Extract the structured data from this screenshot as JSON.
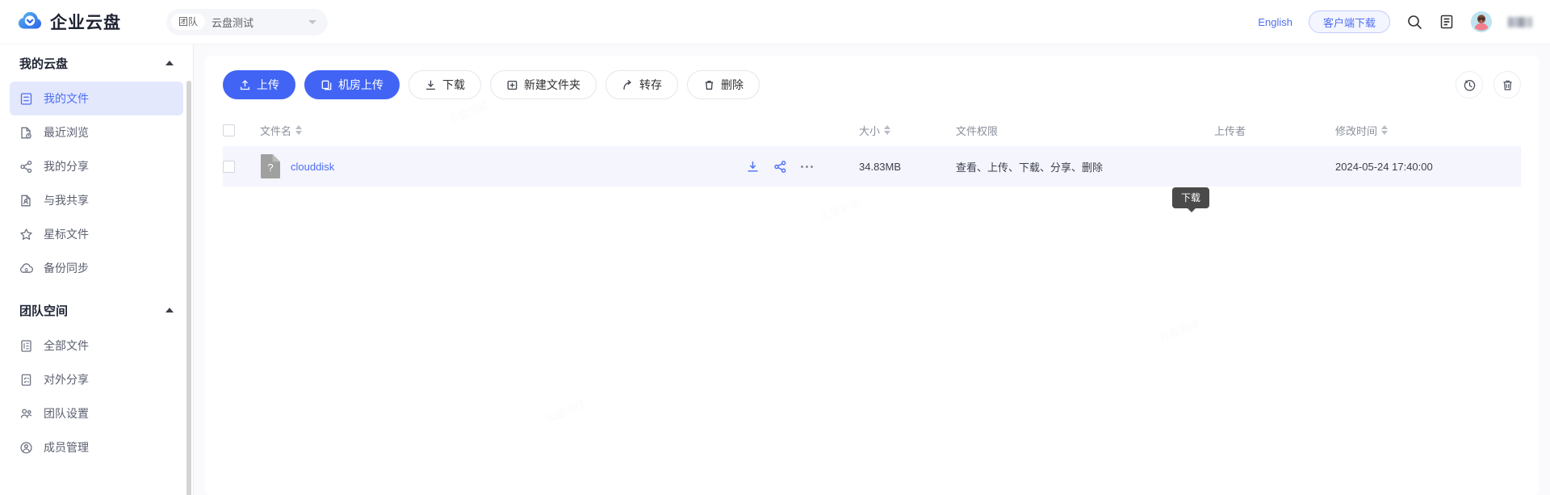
{
  "header": {
    "brand_name": "企业云盘",
    "logo_icon": "cloud-check-icon",
    "team_tag": "团队",
    "team_name": "云盘测试",
    "team_caret_icon": "chevron-down-icon",
    "language_link": "English",
    "client_download": "客户端下载",
    "search_icon": "search-icon",
    "notes_icon": "document-list-icon",
    "avatar_icon": "user-avatar",
    "user_name": ""
  },
  "sidebar": {
    "groups": [
      {
        "title": "我的云盘",
        "collapse_icon": "chevron-up-icon",
        "items": [
          {
            "label": "我的文件",
            "icon": "file-icon",
            "active": true
          },
          {
            "label": "最近浏览",
            "icon": "recent-file-icon",
            "active": false
          },
          {
            "label": "我的分享",
            "icon": "share-icon",
            "active": false
          },
          {
            "label": "与我共享",
            "icon": "shared-with-me-icon",
            "active": false
          },
          {
            "label": "星标文件",
            "icon": "star-icon",
            "active": false
          },
          {
            "label": "备份同步",
            "icon": "cloud-sync-icon",
            "active": false
          }
        ]
      },
      {
        "title": "团队空间",
        "collapse_icon": "chevron-up-icon",
        "items": [
          {
            "label": "全部文件",
            "icon": "list-file-icon",
            "active": false
          },
          {
            "label": "对外分享",
            "icon": "external-share-icon",
            "active": false
          },
          {
            "label": "团队设置",
            "icon": "team-settings-icon",
            "active": false
          },
          {
            "label": "成员管理",
            "icon": "member-manage-icon",
            "active": false
          }
        ]
      }
    ]
  },
  "toolbar": {
    "buttons": [
      {
        "label": "上传",
        "icon": "upload-icon",
        "primary": true
      },
      {
        "label": "机房上传",
        "icon": "server-upload-icon",
        "primary": true
      },
      {
        "label": "下载",
        "icon": "download-icon",
        "primary": false
      },
      {
        "label": "新建文件夹",
        "icon": "new-folder-icon",
        "primary": false
      },
      {
        "label": "转存",
        "icon": "transfer-save-icon",
        "primary": false
      },
      {
        "label": "删除",
        "icon": "trash-icon",
        "primary": false
      }
    ],
    "right_icons": [
      {
        "name": "history-icon"
      },
      {
        "name": "recycle-bin-icon"
      }
    ]
  },
  "table": {
    "columns": [
      {
        "key": "checkbox",
        "label": "",
        "sortable": false
      },
      {
        "key": "name",
        "label": "文件名",
        "sortable": true
      },
      {
        "key": "actions",
        "label": "",
        "sortable": false
      },
      {
        "key": "size",
        "label": "大小",
        "sortable": true
      },
      {
        "key": "permission",
        "label": "文件权限",
        "sortable": false
      },
      {
        "key": "uploader",
        "label": "上传者",
        "sortable": false
      },
      {
        "key": "modified",
        "label": "修改时间",
        "sortable": true
      }
    ],
    "rows": [
      {
        "name": "clouddisk",
        "file_icon": "unknown-file-icon",
        "size": "34.83MB",
        "permission": "查看、上传、下载、分享、删除",
        "uploader": "",
        "modified": "2024-05-24 17:40:00",
        "actions": [
          {
            "name": "download-icon"
          },
          {
            "name": "share-icon"
          },
          {
            "name": "more-icon"
          }
        ]
      }
    ]
  },
  "tooltip": {
    "text": "下载"
  },
  "colors": {
    "primary": "#4264f5",
    "link": "#4e6ef2",
    "active_bg": "#e4e8fd",
    "row_bg": "#f4f5fd",
    "page_bg": "#fafafc",
    "tooltip_bg": "#4a4a4a"
  }
}
